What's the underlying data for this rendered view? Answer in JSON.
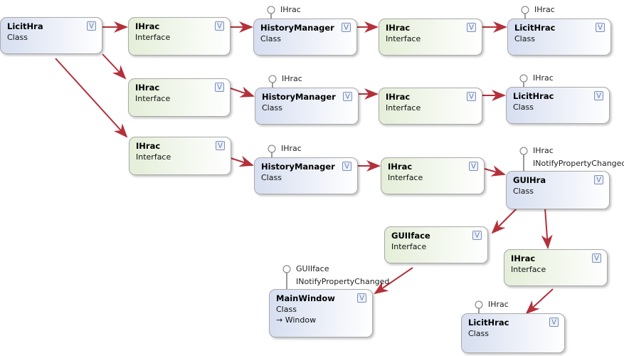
{
  "diagram": {
    "shapes": [
      {
        "name": "LicitHra",
        "kind": "Class",
        "type": "class"
      },
      {
        "name": "IHrac",
        "kind": "Interface",
        "type": "iface"
      },
      {
        "name": "HistoryManager",
        "kind": "Class",
        "type": "class",
        "lollipops": [
          "IHrac"
        ]
      },
      {
        "name": "IHrac",
        "kind": "Interface",
        "type": "iface"
      },
      {
        "name": "LicitHrac",
        "kind": "Class",
        "type": "class",
        "lollipops": [
          "IHrac"
        ]
      },
      {
        "name": "IHrac",
        "kind": "Interface",
        "type": "iface"
      },
      {
        "name": "HistoryManager",
        "kind": "Class",
        "type": "class",
        "lollipops": [
          "IHrac"
        ]
      },
      {
        "name": "IHrac",
        "kind": "Interface",
        "type": "iface"
      },
      {
        "name": "LicitHrac",
        "kind": "Class",
        "type": "class",
        "lollipops": [
          "IHrac"
        ]
      },
      {
        "name": "IHrac",
        "kind": "Interface",
        "type": "iface"
      },
      {
        "name": "HistoryManager",
        "kind": "Class",
        "type": "class",
        "lollipops": [
          "IHrac"
        ]
      },
      {
        "name": "IHrac",
        "kind": "Interface",
        "type": "iface"
      },
      {
        "name": "GUIHra",
        "kind": "Class",
        "type": "class",
        "lollipops": [
          "IHrac",
          "INotifyPropertyChanged"
        ]
      },
      {
        "name": "GUIIface",
        "kind": "Interface",
        "type": "iface"
      },
      {
        "name": "IHrac",
        "kind": "Interface",
        "type": "iface"
      },
      {
        "name": "MainWindow",
        "kind": "Class",
        "type": "class",
        "base": "Window",
        "lollipops": [
          "GUIIface",
          "INotifyPropertyChanged"
        ]
      },
      {
        "name": "LicitHrac",
        "kind": "Class",
        "type": "class",
        "lollipops": [
          "IHrac"
        ]
      }
    ],
    "expand_icon": "chevron-double-down-icon",
    "colors": {
      "arrow": "#b4303a",
      "class_fill": "#d6def0",
      "interface_fill": "#e4eed8"
    }
  }
}
